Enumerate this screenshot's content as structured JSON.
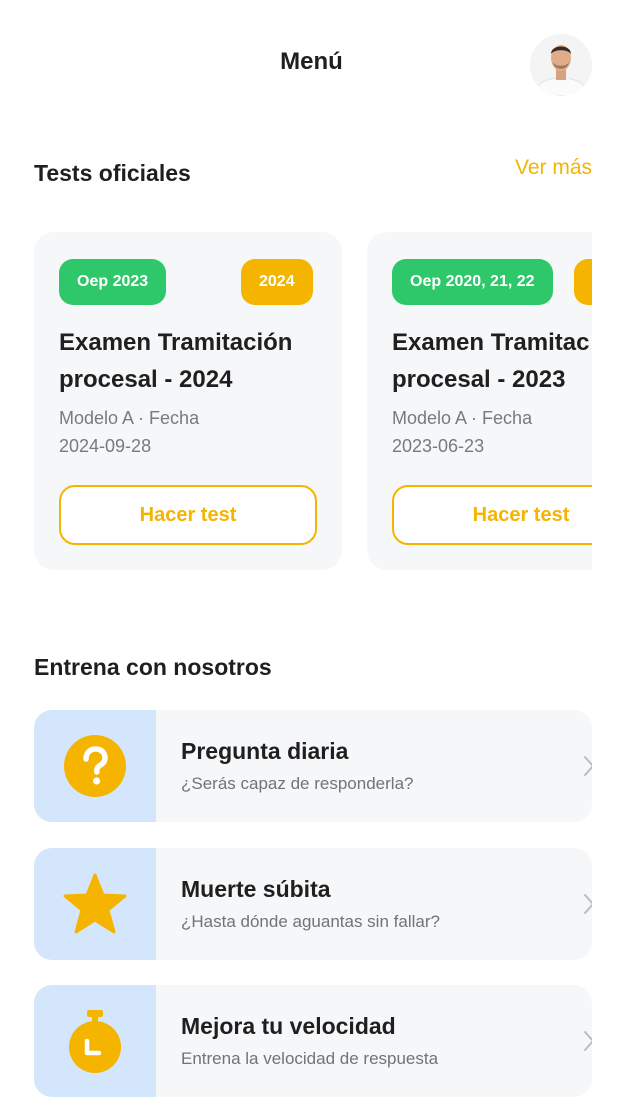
{
  "header": {
    "title": "Menú",
    "avatar_icon": "user-avatar-photo"
  },
  "official_tests": {
    "title": "Tests oficiales",
    "see_more": "Ver más",
    "cards": [
      {
        "badge_left": "Oep 2023",
        "badge_right": "2024",
        "title_line1": "Examen Tramitación",
        "title_line2": "procesal - 2024",
        "meta_line1": "Modelo A · Fecha",
        "meta_line2": "2024-09-28",
        "button": "Hacer test"
      },
      {
        "badge_left": "Oep 2020, 21, 22",
        "badge_right": "",
        "title_line1": "Examen Tramitac",
        "title_line2": "procesal - 2023",
        "meta_line1": "Modelo A · Fecha",
        "meta_line2": "2023-06-23",
        "button": "Hacer test"
      }
    ]
  },
  "training": {
    "title": "Entrena con nosotros",
    "items": [
      {
        "title": "Pregunta diaria",
        "subtitle": "¿Serás capaz de responderla?",
        "icon": "question-icon"
      },
      {
        "title": "Muerte súbita",
        "subtitle": "¿Hasta dónde aguantas sin fallar?",
        "icon": "star-icon"
      },
      {
        "title": "Mejora tu velocidad",
        "subtitle": "Entrena la velocidad de respuesta",
        "icon": "stopwatch-icon"
      }
    ]
  },
  "colors": {
    "accent_yellow": "#f5b400",
    "badge_green": "#2ec86b",
    "icon_bg_blue": "#d4e6fb",
    "card_bg": "#f6f7f9"
  }
}
